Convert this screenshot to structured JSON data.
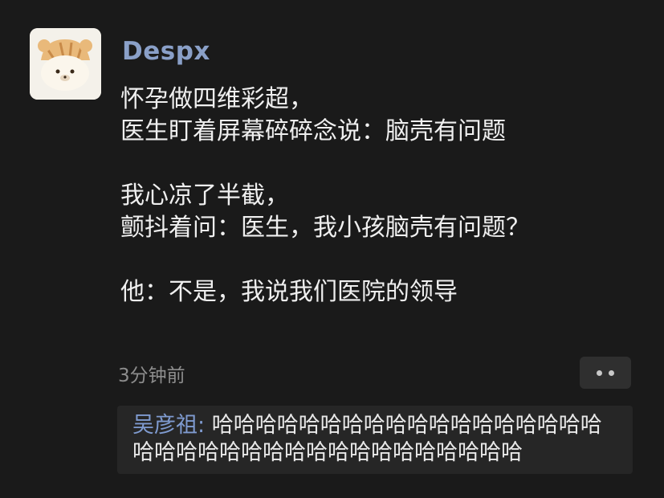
{
  "post": {
    "author": "Despx",
    "lines": [
      "怀孕做四维彩超，",
      "医生盯着屏幕碎碎念说：脑壳有问题",
      "",
      "我心凉了半截，",
      "颤抖着问：医生，我小孩脑壳有问题？",
      "",
      "他：不是，我说我们医院的领导"
    ],
    "timestamp": "3分钟前",
    "more_icon": "more-dots-icon"
  },
  "comment": {
    "author": "吴彦祖",
    "separator": ":",
    "text": "哈哈哈哈哈哈哈哈哈哈哈哈哈哈哈哈哈哈哈哈哈哈哈哈哈哈哈哈哈哈哈哈哈哈哈哈"
  },
  "colors": {
    "background": "#1a1a1a",
    "username": "#8aa0c8",
    "text": "#efefef",
    "muted": "#8d8d8d",
    "comment_bg": "#262626",
    "comment_author": "#7f9bd0"
  }
}
